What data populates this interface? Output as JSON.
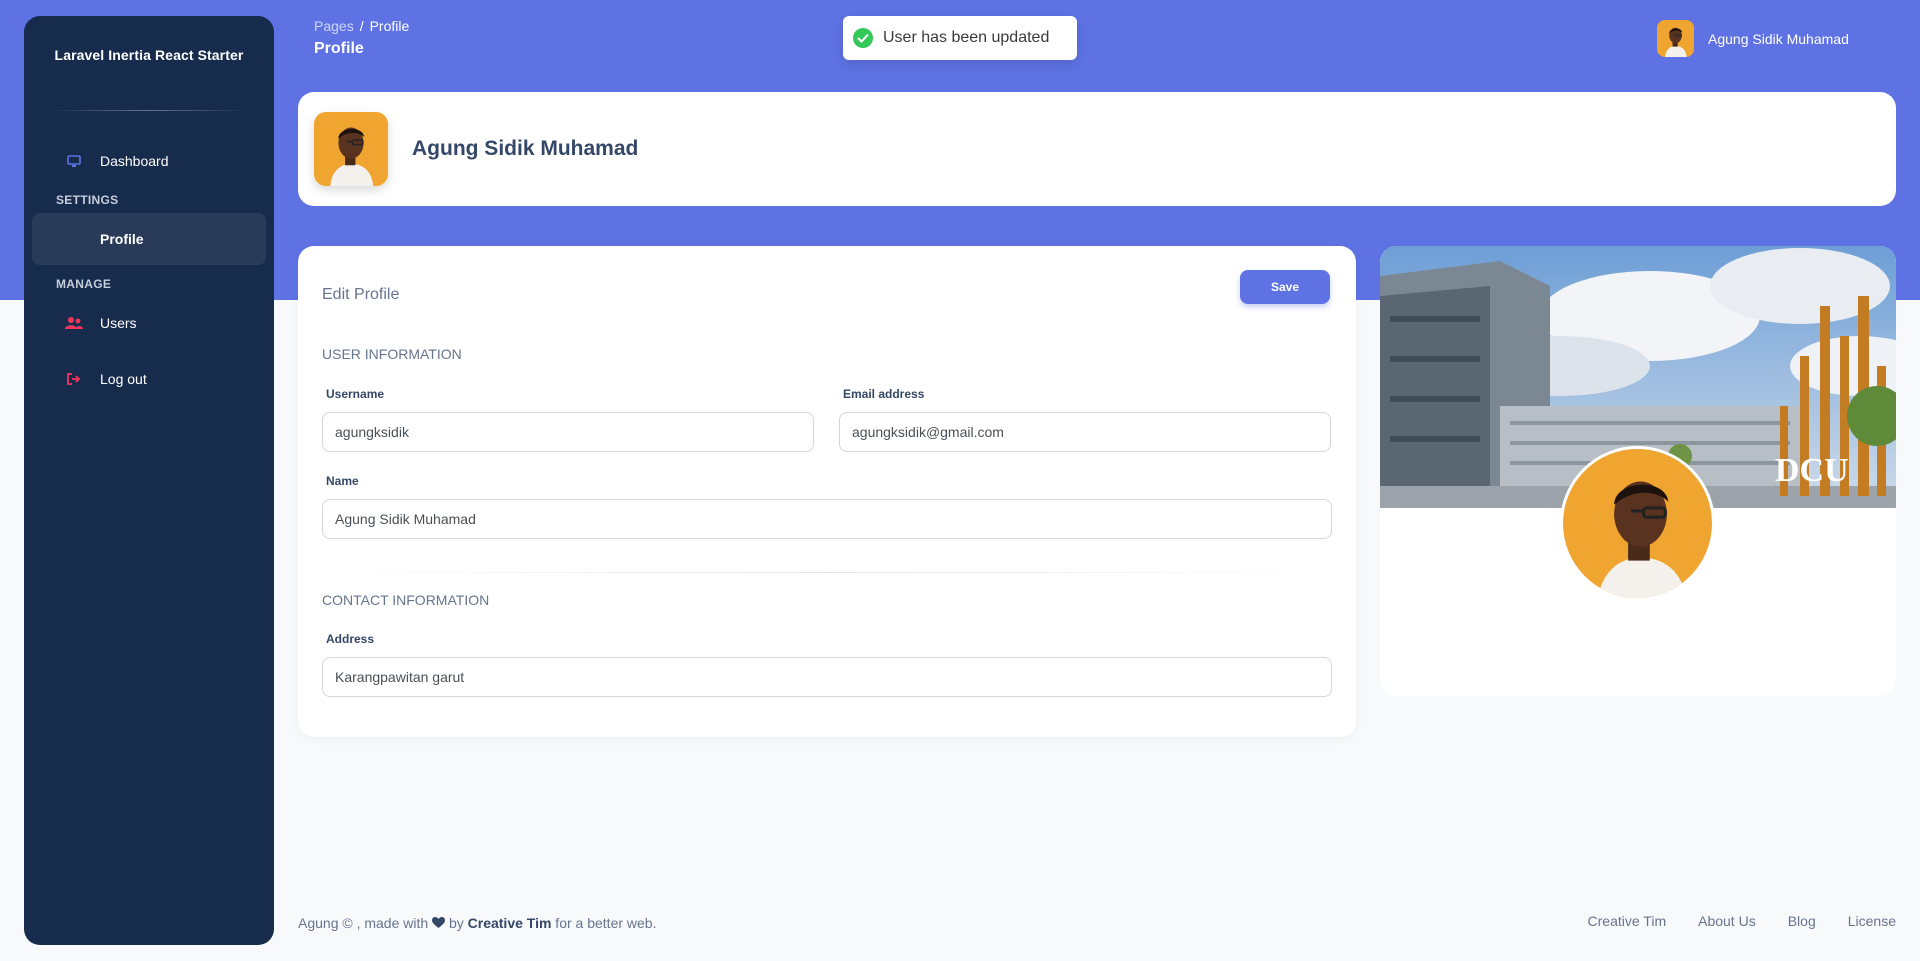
{
  "brand": {
    "title": "Laravel Inertia React Starter"
  },
  "sidebar": {
    "items": [
      {
        "label": "Dashboard",
        "icon": "monitor-icon"
      },
      {
        "heading": "Settings"
      },
      {
        "label": "Profile",
        "active": true
      },
      {
        "heading": "Manage"
      },
      {
        "label": "Users",
        "icon": "users-icon"
      },
      {
        "label": "Log out",
        "icon": "logout-icon"
      }
    ]
  },
  "navbar": {
    "breadcrumb_parent": "Pages",
    "breadcrumb_sep": "/",
    "breadcrumb_current": "Profile",
    "page_title": "Profile",
    "user_name": "Agung Sidik Muhamad"
  },
  "toast": {
    "message": "User has been updated",
    "icon": "check-circle-icon"
  },
  "header": {
    "name": "Agung Sidik Muhamad"
  },
  "form": {
    "title": "Edit Profile",
    "save_label": "Save",
    "user_section": "USER INFORMATION",
    "username_label": "Username",
    "username_value": "agungksidik",
    "email_label": "Email address",
    "email_value": "agungksidik@gmail.com",
    "name_label": "Name",
    "name_value": "Agung Sidik Muhamad",
    "contact_section": "CONTACT INFORMATION",
    "address_label": "Address",
    "address_value": "Karangpawitan garut"
  },
  "profile_card": {
    "cover_text": "DCU"
  },
  "footer": {
    "prefix": "Agung © , made with ",
    "by": " by ",
    "author": "Creative Tim",
    "suffix": " for a better web.",
    "links": [
      "Creative Tim",
      "About Us",
      "Blog",
      "License"
    ]
  },
  "colors": {
    "primary": "#5e72e4",
    "sidebar": "#172b4d",
    "success": "#34c759",
    "danger": "#f5365c"
  }
}
